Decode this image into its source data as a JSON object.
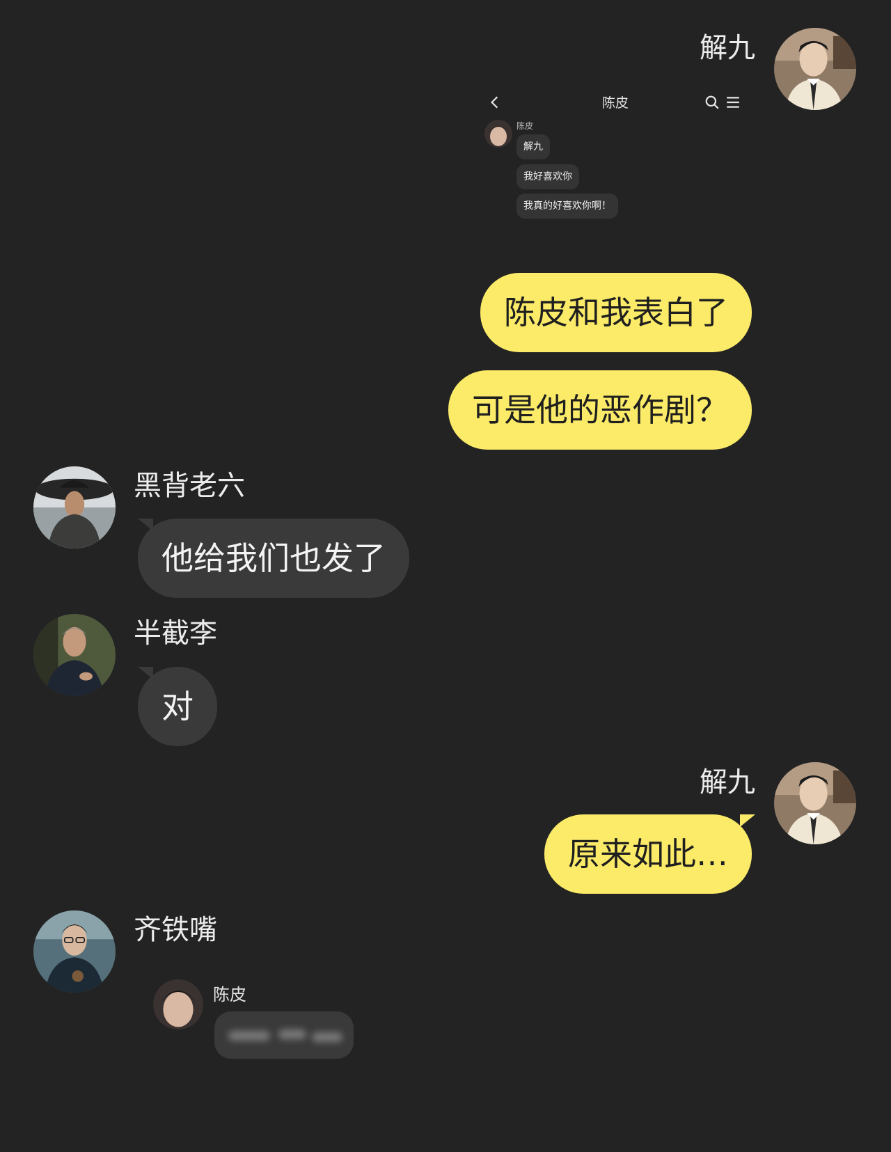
{
  "messages": [
    {
      "sender": "解九",
      "side": "right",
      "forwarded_screenshot": {
        "title": "陈皮",
        "sender": "陈皮",
        "lines": [
          "解九",
          "我好喜欢你",
          "我真的好喜欢你啊！"
        ],
        "icons": [
          "back-chevron-icon",
          "search-icon",
          "menu-icon"
        ]
      },
      "bubbles": [
        "陈皮和我表白了",
        "可是他的恶作剧？"
      ]
    },
    {
      "sender": "黑背老六",
      "side": "left",
      "bubbles": [
        "他给我们也发了"
      ]
    },
    {
      "sender": "半截李",
      "side": "left",
      "bubbles": [
        "对"
      ]
    },
    {
      "sender": "解九",
      "side": "right",
      "bubbles": [
        "原来如此…"
      ]
    },
    {
      "sender": "齐铁嘴",
      "side": "left",
      "forwarded_reply": {
        "sender": "陈皮",
        "content_blurred": true
      }
    }
  ],
  "colors": {
    "background": "#232323",
    "self_bubble": "#fbeb68",
    "other_bubble": "#3a3a3a",
    "text_light": "#ececec",
    "text_dark": "#1f1f1f"
  }
}
